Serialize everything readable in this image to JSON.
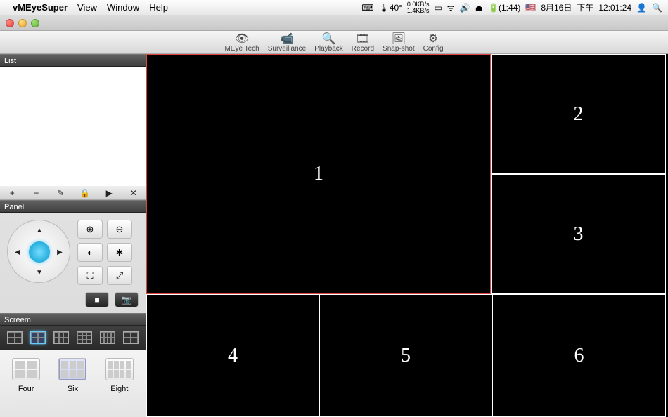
{
  "menubar": {
    "app_name": "vMEyeSuper",
    "items": [
      "View",
      "Window",
      "Help"
    ],
    "status": {
      "temp": "40°",
      "net_up": "0.0KB/s",
      "net_down": "1.4KB/s",
      "battery": "(1:44)",
      "date": "8月16日",
      "daypart": "下午",
      "time": "12:01:24"
    }
  },
  "toolbar": {
    "items": [
      {
        "label": "MEye Tech",
        "icon": "👁"
      },
      {
        "label": "Surveillance",
        "icon": "📹"
      },
      {
        "label": "Playback",
        "icon": "🔍"
      },
      {
        "label": "Record",
        "icon": "🎞"
      },
      {
        "label": "Snap-shot",
        "icon": "🖼"
      },
      {
        "label": "Config",
        "icon": "⚙"
      }
    ]
  },
  "sidebar": {
    "list_title": "List",
    "panel_title": "Panel",
    "screen_title": "Screem",
    "list_tools": [
      "+",
      "−",
      "✎",
      "🔒",
      "▶",
      "✕"
    ],
    "ptz_buttons": [
      "⊕",
      "⊖",
      "◐",
      "✱",
      "⛶",
      "⤢"
    ],
    "layouts": [
      {
        "label": "Four"
      },
      {
        "label": "Six"
      },
      {
        "label": "Eight"
      }
    ]
  },
  "video": {
    "cells": [
      "1",
      "2",
      "3",
      "4",
      "5",
      "6"
    ],
    "selected": 1
  }
}
